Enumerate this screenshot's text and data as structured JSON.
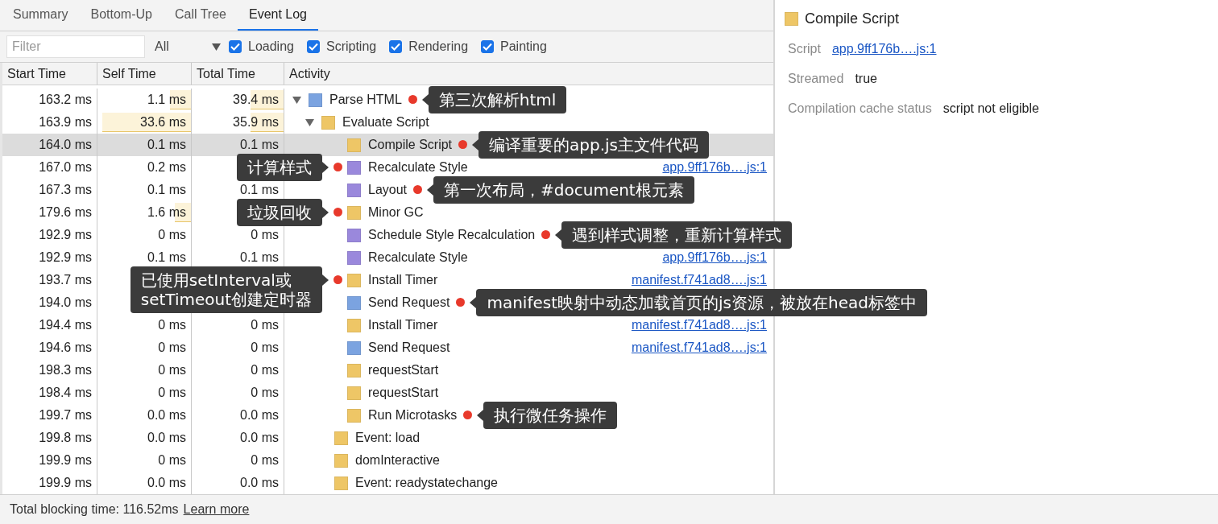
{
  "tabs": [
    {
      "label": "Summary",
      "selected": false
    },
    {
      "label": "Bottom-Up",
      "selected": false
    },
    {
      "label": "Call Tree",
      "selected": false
    },
    {
      "label": "Event Log",
      "selected": true
    }
  ],
  "toolbar": {
    "filter": {
      "placeholder": "Filter"
    },
    "dropdown": {
      "value": "All"
    },
    "checkboxes": [
      {
        "label": "Loading",
        "checked": true
      },
      {
        "label": "Scripting",
        "checked": true
      },
      {
        "label": "Rendering",
        "checked": true
      },
      {
        "label": "Painting",
        "checked": true
      }
    ]
  },
  "table": {
    "columns": [
      "Start Time",
      "Self Time",
      "Total Time",
      "Activity"
    ],
    "rows": [
      {
        "start": "163.2 ms",
        "self": {
          "text": "1.1 ms",
          "level": 0.22
        },
        "total": {
          "text": "39.4 ms",
          "level": 0.36
        },
        "activity": "Parse HTML",
        "color": "#7ba3e0",
        "expanded": true,
        "selected": false,
        "annotation": {
          "text": "第三次解析html",
          "kind": "after"
        },
        "children": [
          {
            "start": "163.9 ms",
            "self": {
              "text": "33.6 ms",
              "level": 0.95
            },
            "total": {
              "text": "35.9 ms",
              "level": 0.36
            },
            "activity": "Evaluate Script",
            "color": "#eec666",
            "expanded": true,
            "selected": false,
            "children": [
              {
                "start": "164.0 ms",
                "self": {
                  "text": "0.1 ms"
                },
                "total": {
                  "text": "0.1 ms"
                },
                "activity": "Compile Script",
                "color": "#eec666",
                "selected": true,
                "annotation": {
                  "text": "编译重要的app.js主文件代码",
                  "kind": "after"
                }
              },
              {
                "start": "167.0 ms",
                "self": {
                  "text": "0.2 ms"
                },
                "activity": "Recalculate Style",
                "color": "#9a88dc",
                "selected": false,
                "link": "app.9ff176b….js:1",
                "annotation": {
                  "text": "计算样式",
                  "kind": "before"
                }
              },
              {
                "start": "167.3 ms",
                "self": {
                  "text": "0.1 ms"
                },
                "total": {
                  "text": "0.1 ms"
                },
                "activity": "Layout",
                "color": "#9a88dc",
                "selected": false,
                "annotation": {
                  "text": "第一次布局，#document根元素",
                  "kind": "after"
                }
              },
              {
                "start": "179.6 ms",
                "self": {
                  "text": "1.6 ms",
                  "level": 0.17
                },
                "activity": "Minor GC",
                "color": "#eec666",
                "selected": false,
                "annotation": {
                  "text": "垃圾回收",
                  "kind": "before"
                }
              },
              {
                "start": "192.9 ms",
                "self": {
                  "text": "0 ms"
                },
                "total": {
                  "text": "0 ms"
                },
                "activity": "Schedule Style Recalculation",
                "color": "#9a88dc",
                "selected": false,
                "annotation": {
                  "text": "遇到样式调整，重新计算样式",
                  "kind": "after"
                }
              },
              {
                "start": "192.9 ms",
                "self": {
                  "text": "0.1 ms"
                },
                "total": {
                  "text": "0.1 ms"
                },
                "activity": "Recalculate Style",
                "color": "#9a88dc",
                "selected": false,
                "link": "app.9ff176b….js:1"
              },
              {
                "start": "193.7 ms",
                "activity": "Install Timer",
                "color": "#eec666",
                "selected": false,
                "link": "manifest.f741ad8….js:1",
                "annotation": {
                  "text": "已使用setInterval或\nsetTimeout创建定时器",
                  "kind": "before"
                }
              },
              {
                "start": "194.0 ms",
                "activity": "Send Request",
                "color": "#7ba3e0",
                "selected": false,
                "annotation": {
                  "text": "manifest映射中动态加载首页的js资源，被放在head标签中",
                  "kind": "after"
                }
              },
              {
                "start": "194.4 ms",
                "self": {
                  "text": "0 ms"
                },
                "total": {
                  "text": "0 ms"
                },
                "activity": "Install Timer",
                "color": "#eec666",
                "selected": false,
                "link": "manifest.f741ad8….js:1"
              },
              {
                "start": "194.6 ms",
                "self": {
                  "text": "0 ms"
                },
                "total": {
                  "text": "0 ms"
                },
                "activity": "Send Request",
                "color": "#7ba3e0",
                "selected": false,
                "link": "manifest.f741ad8….js:1"
              },
              {
                "start": "198.3 ms",
                "self": {
                  "text": "0 ms"
                },
                "total": {
                  "text": "0 ms"
                },
                "activity": "requestStart",
                "color": "#eec666",
                "selected": false
              },
              {
                "start": "198.4 ms",
                "self": {
                  "text": "0 ms"
                },
                "total": {
                  "text": "0 ms"
                },
                "activity": "requestStart",
                "color": "#eec666",
                "selected": false
              },
              {
                "start": "199.7 ms",
                "self": {
                  "text": "0.0 ms"
                },
                "total": {
                  "text": "0.0 ms"
                },
                "activity": "Run Microtasks",
                "color": "#eec666",
                "selected": false,
                "annotation": {
                  "text": "执行微任务操作",
                  "kind": "after"
                }
              }
            ]
          },
          {
            "start": "199.8 ms",
            "self": {
              "text": "0.0 ms"
            },
            "total": {
              "text": "0.0 ms"
            },
            "activity": "Event: load",
            "color": "#eec666",
            "selected": false
          },
          {
            "start": "199.9 ms",
            "self": {
              "text": "0 ms"
            },
            "total": {
              "text": "0 ms"
            },
            "activity": "domInteractive",
            "color": "#eec666",
            "selected": false
          },
          {
            "start": "199.9 ms",
            "self": {
              "text": "0.0 ms"
            },
            "total": {
              "text": "0.0 ms"
            },
            "activity": "Event: readystatechange",
            "color": "#eec666",
            "selected": false
          }
        ]
      }
    ]
  },
  "details": {
    "title": "Compile Script",
    "color": "#eec666",
    "fields": [
      {
        "label": "Script",
        "value": "app.9ff176b….js:1",
        "kind": "link"
      },
      {
        "label": "Streamed",
        "value": "true",
        "kind": "text"
      },
      {
        "label": "Compilation cache status",
        "value": "script not eligible",
        "kind": "text"
      }
    ]
  },
  "status_bar": {
    "text": "Total blocking time: 116.52ms",
    "link": "Learn more"
  }
}
